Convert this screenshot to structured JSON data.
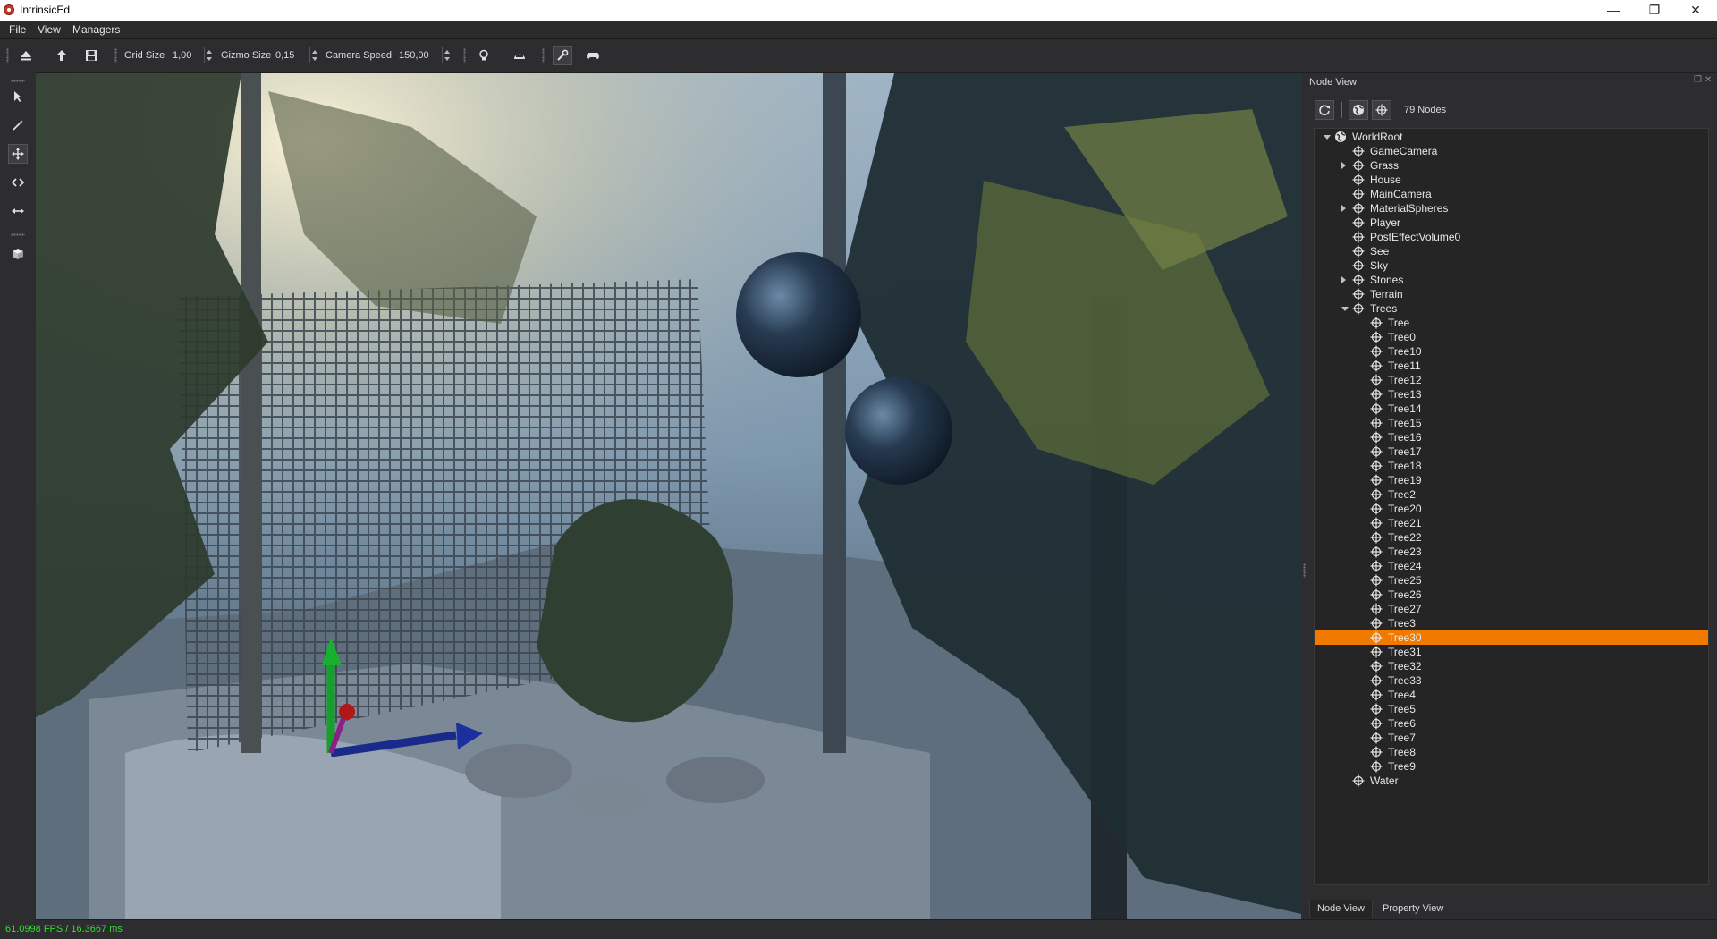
{
  "window": {
    "title": "IntrinsicEd",
    "controls": [
      "—",
      "❐",
      "✕"
    ]
  },
  "menubar": {
    "items": [
      "File",
      "View",
      "Managers"
    ]
  },
  "toolbar": {
    "grid_size_label": "Grid Size",
    "grid_size_value": "1,00",
    "gizmo_size_label": "Gizmo Size",
    "gizmo_size_value": "0,15",
    "camera_speed_label": "Camera Speed",
    "camera_speed_value": "150,00",
    "icons": [
      "eject-icon",
      "arrow-up-icon",
      "save-icon",
      "lightbulb-icon",
      "helmet-icon",
      "wrench-icon",
      "gamepad-icon"
    ]
  },
  "left_tools": [
    "select-arrow-icon",
    "magic-wand-icon",
    "move-icon",
    "rotate-icon",
    "scale-icon",
    "cube-icon"
  ],
  "node_view": {
    "title": "Node View",
    "node_count": "79 Nodes",
    "nodes": [
      {
        "label": "WorldRoot",
        "depth": 0,
        "expander": "open",
        "icon": "globe"
      },
      {
        "label": "GameCamera",
        "depth": 1,
        "expander": "none",
        "icon": "node"
      },
      {
        "label": "Grass",
        "depth": 1,
        "expander": "closed",
        "icon": "node"
      },
      {
        "label": "House",
        "depth": 1,
        "expander": "none",
        "icon": "node"
      },
      {
        "label": "MainCamera",
        "depth": 1,
        "expander": "none",
        "icon": "node"
      },
      {
        "label": "MaterialSpheres",
        "depth": 1,
        "expander": "closed",
        "icon": "node"
      },
      {
        "label": "Player",
        "depth": 1,
        "expander": "none",
        "icon": "node"
      },
      {
        "label": "PostEffectVolume0",
        "depth": 1,
        "expander": "none",
        "icon": "node"
      },
      {
        "label": "See",
        "depth": 1,
        "expander": "none",
        "icon": "node"
      },
      {
        "label": "Sky",
        "depth": 1,
        "expander": "none",
        "icon": "node"
      },
      {
        "label": "Stones",
        "depth": 1,
        "expander": "closed",
        "icon": "node"
      },
      {
        "label": "Terrain",
        "depth": 1,
        "expander": "none",
        "icon": "node"
      },
      {
        "label": "Trees",
        "depth": 1,
        "expander": "open",
        "icon": "node"
      },
      {
        "label": "Tree",
        "depth": 2,
        "expander": "none",
        "icon": "node"
      },
      {
        "label": "Tree0",
        "depth": 2,
        "expander": "none",
        "icon": "node"
      },
      {
        "label": "Tree10",
        "depth": 2,
        "expander": "none",
        "icon": "node"
      },
      {
        "label": "Tree11",
        "depth": 2,
        "expander": "none",
        "icon": "node"
      },
      {
        "label": "Tree12",
        "depth": 2,
        "expander": "none",
        "icon": "node"
      },
      {
        "label": "Tree13",
        "depth": 2,
        "expander": "none",
        "icon": "node"
      },
      {
        "label": "Tree14",
        "depth": 2,
        "expander": "none",
        "icon": "node"
      },
      {
        "label": "Tree15",
        "depth": 2,
        "expander": "none",
        "icon": "node"
      },
      {
        "label": "Tree16",
        "depth": 2,
        "expander": "none",
        "icon": "node"
      },
      {
        "label": "Tree17",
        "depth": 2,
        "expander": "none",
        "icon": "node"
      },
      {
        "label": "Tree18",
        "depth": 2,
        "expander": "none",
        "icon": "node"
      },
      {
        "label": "Tree19",
        "depth": 2,
        "expander": "none",
        "icon": "node"
      },
      {
        "label": "Tree2",
        "depth": 2,
        "expander": "none",
        "icon": "node"
      },
      {
        "label": "Tree20",
        "depth": 2,
        "expander": "none",
        "icon": "node"
      },
      {
        "label": "Tree21",
        "depth": 2,
        "expander": "none",
        "icon": "node"
      },
      {
        "label": "Tree22",
        "depth": 2,
        "expander": "none",
        "icon": "node"
      },
      {
        "label": "Tree23",
        "depth": 2,
        "expander": "none",
        "icon": "node"
      },
      {
        "label": "Tree24",
        "depth": 2,
        "expander": "none",
        "icon": "node"
      },
      {
        "label": "Tree25",
        "depth": 2,
        "expander": "none",
        "icon": "node"
      },
      {
        "label": "Tree26",
        "depth": 2,
        "expander": "none",
        "icon": "node"
      },
      {
        "label": "Tree27",
        "depth": 2,
        "expander": "none",
        "icon": "node"
      },
      {
        "label": "Tree3",
        "depth": 2,
        "expander": "none",
        "icon": "node"
      },
      {
        "label": "Tree30",
        "depth": 2,
        "expander": "none",
        "icon": "node",
        "selected": true
      },
      {
        "label": "Tree31",
        "depth": 2,
        "expander": "none",
        "icon": "node"
      },
      {
        "label": "Tree32",
        "depth": 2,
        "expander": "none",
        "icon": "node"
      },
      {
        "label": "Tree33",
        "depth": 2,
        "expander": "none",
        "icon": "node"
      },
      {
        "label": "Tree4",
        "depth": 2,
        "expander": "none",
        "icon": "node"
      },
      {
        "label": "Tree5",
        "depth": 2,
        "expander": "none",
        "icon": "node"
      },
      {
        "label": "Tree6",
        "depth": 2,
        "expander": "none",
        "icon": "node"
      },
      {
        "label": "Tree7",
        "depth": 2,
        "expander": "none",
        "icon": "node"
      },
      {
        "label": "Tree8",
        "depth": 2,
        "expander": "none",
        "icon": "node"
      },
      {
        "label": "Tree9",
        "depth": 2,
        "expander": "none",
        "icon": "node"
      },
      {
        "label": "Water",
        "depth": 1,
        "expander": "none",
        "icon": "node"
      }
    ]
  },
  "tabs": [
    "Node View",
    "Property View"
  ],
  "status": {
    "fps": "61.0998 FPS / 16.3667 ms"
  },
  "colors": {
    "selection": "#f07a00",
    "fps_text": "#33dd33",
    "panel_bg": "#2d2d30",
    "tree_bg": "#252526"
  }
}
